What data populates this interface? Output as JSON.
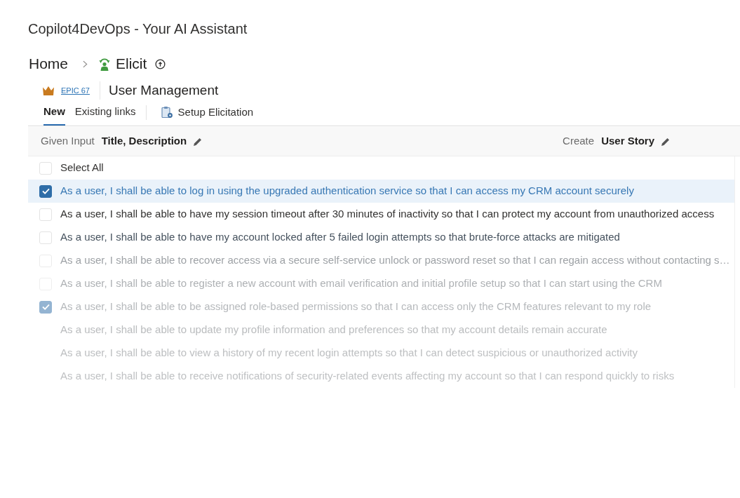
{
  "app_title": "Copilot4DevOps - Your AI Assistant",
  "breadcrumb": [
    {
      "label": "Home"
    },
    {
      "label": "Elicit"
    }
  ],
  "work_item": {
    "id_label": "EPIC 67",
    "title": "User Management"
  },
  "tabs": [
    {
      "label": "New",
      "selected": true
    },
    {
      "label": "Existing links",
      "selected": false
    }
  ],
  "setup_button": {
    "label": "Setup Elicitation"
  },
  "input_bar": {
    "given_input_label": "Given Input",
    "given_input_value": "Title, Description",
    "create_label": "Create",
    "create_value": "User Story"
  },
  "select_all": {
    "label": "Select All",
    "checked": false
  },
  "requirements": [
    {
      "text": "As a user, I shall be able to log in using the upgraded authentication service so that I can access my CRM account securely",
      "checked": true,
      "selected": true,
      "color": "#3878b4"
    },
    {
      "text": "As a user, I shall be able to have my session timeout after 30 minutes of inactivity so that I can protect my account from unauthorized access",
      "checked": false,
      "selected": false,
      "color": "#323130"
    },
    {
      "text": "As a user, I shall be able to have my account locked after 5 failed login attempts so that brute-force attacks are mitigated",
      "checked": false,
      "selected": false,
      "color": "#46525e"
    },
    {
      "text": "As a user, I shall be able to recover access via a secure self-service unlock or password reset so that I can regain access without contacting s…",
      "checked": false,
      "selected": false,
      "color": "#9ea2a6"
    },
    {
      "text": "As a user, I shall be able to register a new account with email verification and initial profile setup so that I can start using the CRM",
      "checked": false,
      "selected": false,
      "color": "#aeb1b4"
    },
    {
      "text": "As a user, I shall be able to be assigned role-based permissions so that I can access only the CRM features relevant to my role",
      "checked": true,
      "selected": false,
      "color": "#b6b9bc"
    },
    {
      "text": "As a user, I shall be able to update my profile information and preferences so that my account details remain accurate",
      "selected": false,
      "color": "#babcbe"
    },
    {
      "text": "As a user, I shall be able to view a history of my recent login attempts so that I can detect suspicious or unauthorized activity",
      "selected": false,
      "color": "#bdbfc1"
    },
    {
      "text": "As a user, I shall be able to receive notifications of security-related events affecting my account so that I can respond quickly to risks",
      "selected": false,
      "color": "#bfc1c3"
    }
  ]
}
